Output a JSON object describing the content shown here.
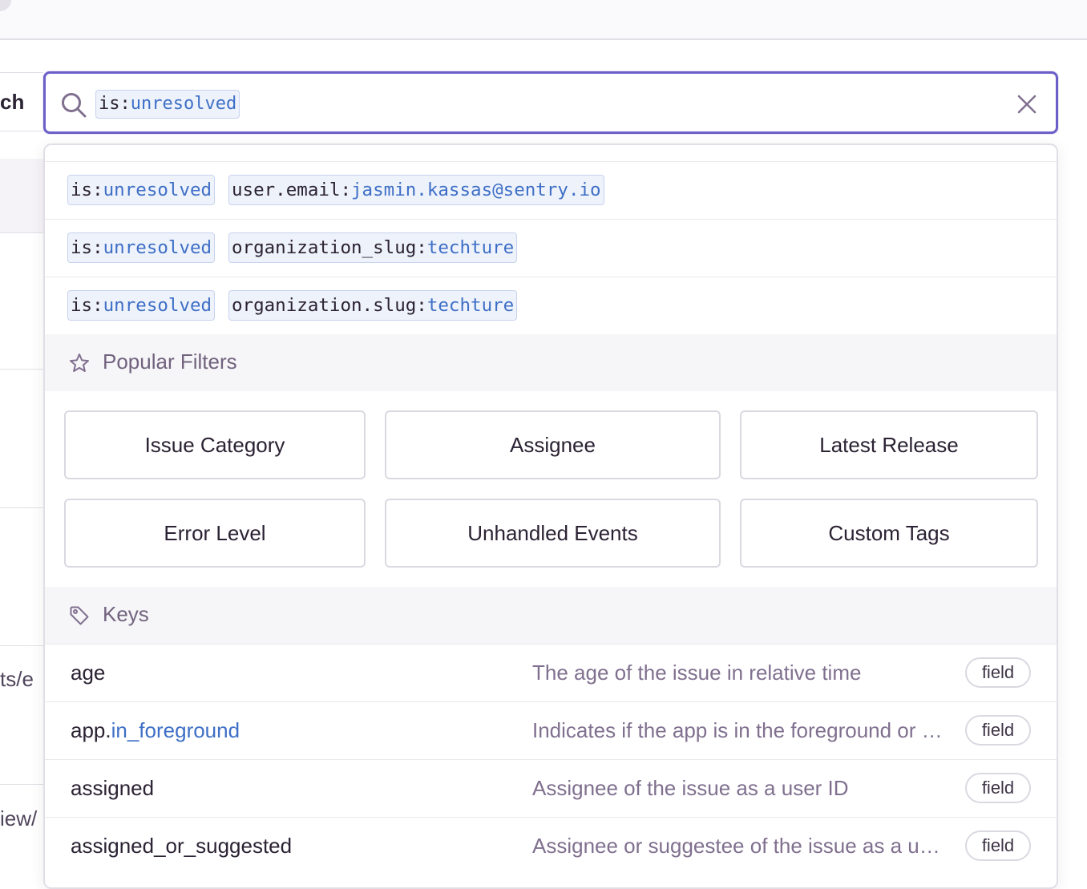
{
  "page": {
    "left_label": "ch",
    "bg_texts": [
      "ts/e",
      "iew/"
    ]
  },
  "search": {
    "token_key": "is:",
    "token_value": "unresolved",
    "icon": "search-icon",
    "clear_icon": "close-icon"
  },
  "recent": [
    {
      "tokens": [
        {
          "key": "is:",
          "value": "unresolved"
        },
        {
          "key": "user.email:",
          "value": "jasmin.kassas@sentry.io"
        }
      ]
    },
    {
      "tokens": [
        {
          "key": "is:",
          "value": "unresolved"
        },
        {
          "key": "organization_slug:",
          "value": "techture"
        }
      ]
    },
    {
      "tokens": [
        {
          "key": "is:",
          "value": "unresolved"
        },
        {
          "key": "organization.slug:",
          "value": "techture"
        }
      ]
    }
  ],
  "popular": {
    "icon": "star-icon",
    "title": "Popular Filters",
    "buttons": [
      "Issue Category",
      "Assignee",
      "Latest Release",
      "Error Level",
      "Unhandled Events",
      "Custom Tags"
    ]
  },
  "keys": {
    "icon": "tag-icon",
    "title": "Keys",
    "rows": [
      {
        "name": "age",
        "name_accent": "",
        "desc": "The age of the issue in relative time",
        "badge": "field"
      },
      {
        "name": "app.",
        "name_accent": "in_foreground",
        "desc": "Indicates if the app is in the foreground or background",
        "badge": "field"
      },
      {
        "name": "assigned",
        "name_accent": "",
        "desc": "Assignee of the issue as a user ID",
        "badge": "field"
      },
      {
        "name": "assigned_or_suggested",
        "name_accent": "",
        "desc": "Assignee or suggestee of the issue as a user ID",
        "badge": "field"
      }
    ]
  },
  "colors": {
    "accent": "#6c5fc7",
    "token_value": "#3e6fc6",
    "muted_text": "#80708f"
  }
}
